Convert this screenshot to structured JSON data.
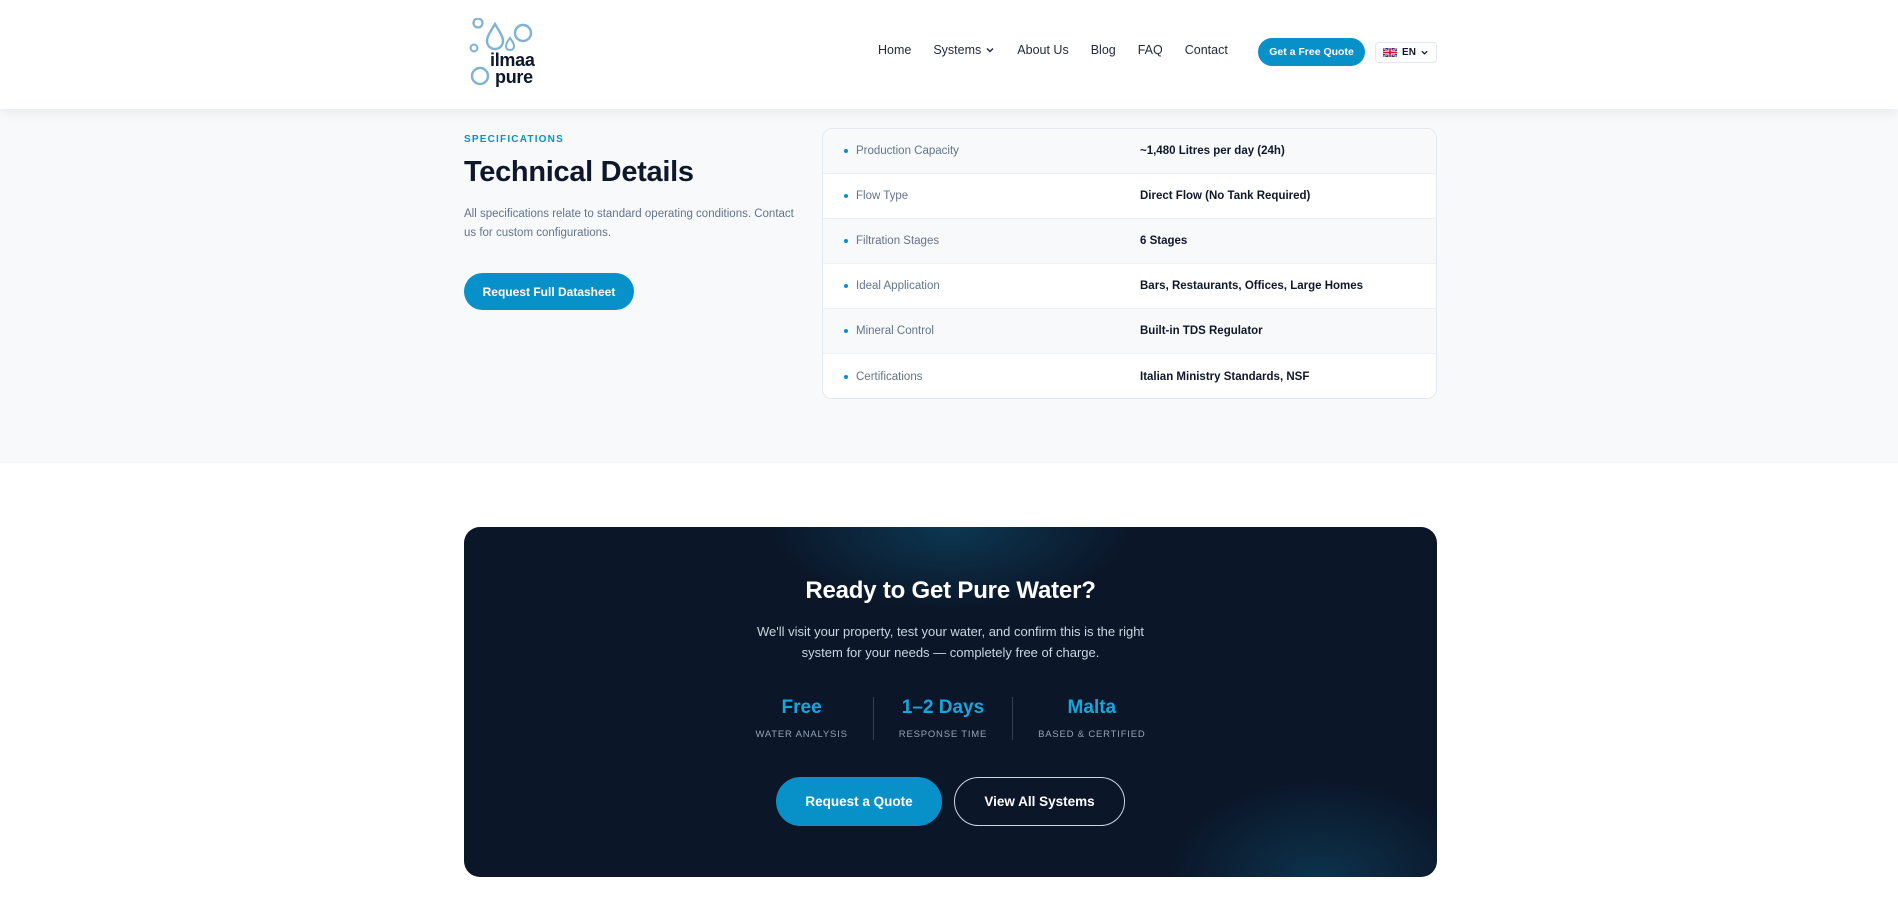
{
  "brand": {
    "line1": "ilmaa",
    "line2": "pure",
    "accent": "#0891c8"
  },
  "nav": {
    "items": [
      {
        "label": "Home"
      },
      {
        "label": "Systems",
        "has_dropdown": true
      },
      {
        "label": "About Us"
      },
      {
        "label": "Blog"
      },
      {
        "label": "FAQ"
      },
      {
        "label": "Contact"
      }
    ],
    "cta_label": "Get a Free Quote",
    "language": "EN",
    "language_icon": "uk-flag-icon"
  },
  "specs": {
    "eyebrow": "SPECIFICATIONS",
    "title": "Technical Details",
    "description": "All specifications relate to standard operating conditions. Contact us for custom configurations.",
    "button_label": "Request Full Datasheet",
    "rows": [
      {
        "label": "Production Capacity",
        "value": "~1,480 Litres per day (24h)"
      },
      {
        "label": "Flow Type",
        "value": "Direct Flow (No Tank Required)"
      },
      {
        "label": "Filtration Stages",
        "value": "6 Stages"
      },
      {
        "label": "Ideal Application",
        "value": "Bars, Restaurants, Offices, Large Homes"
      },
      {
        "label": "Mineral Control",
        "value": "Built-in TDS Regulator"
      },
      {
        "label": "Certifications",
        "value": "Italian Ministry Standards, NSF"
      }
    ]
  },
  "cta": {
    "title": "Ready to Get Pure Water?",
    "subtitle": "We'll visit your property, test your water, and confirm this is the right system for your needs — completely free of charge.",
    "stats": [
      {
        "value": "Free",
        "label": "WATER ANALYSIS"
      },
      {
        "value": "1–2 Days",
        "label": "RESPONSE TIME"
      },
      {
        "value": "Malta",
        "label": "BASED & CERTIFIED"
      }
    ],
    "primary_label": "Request a Quote",
    "secondary_label": "View All Systems"
  }
}
